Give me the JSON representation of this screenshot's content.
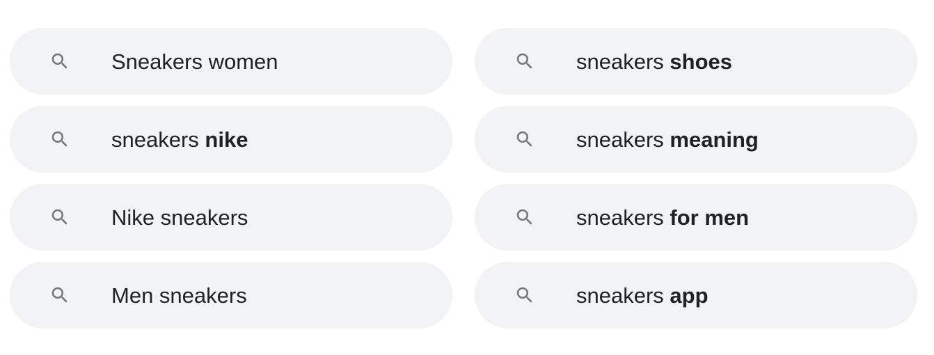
{
  "suggestions": [
    {
      "icon": "search-icon",
      "prefix": "Sneakers women",
      "suffix": ""
    },
    {
      "icon": "search-icon",
      "prefix": "sneakers ",
      "suffix": "shoes"
    },
    {
      "icon": "search-icon",
      "prefix": "sneakers ",
      "suffix": "nike"
    },
    {
      "icon": "search-icon",
      "prefix": "sneakers ",
      "suffix": "meaning"
    },
    {
      "icon": "search-icon",
      "prefix": "Nike sneakers",
      "suffix": ""
    },
    {
      "icon": "search-icon",
      "prefix": "sneakers ",
      "suffix": "for men"
    },
    {
      "icon": "search-icon",
      "prefix": "Men sneakers",
      "suffix": ""
    },
    {
      "icon": "search-icon",
      "prefix": "sneakers ",
      "suffix": "app"
    }
  ],
  "colors": {
    "chip_background": "#f1f3f4",
    "text": "#202124",
    "icon": "#70757a"
  }
}
